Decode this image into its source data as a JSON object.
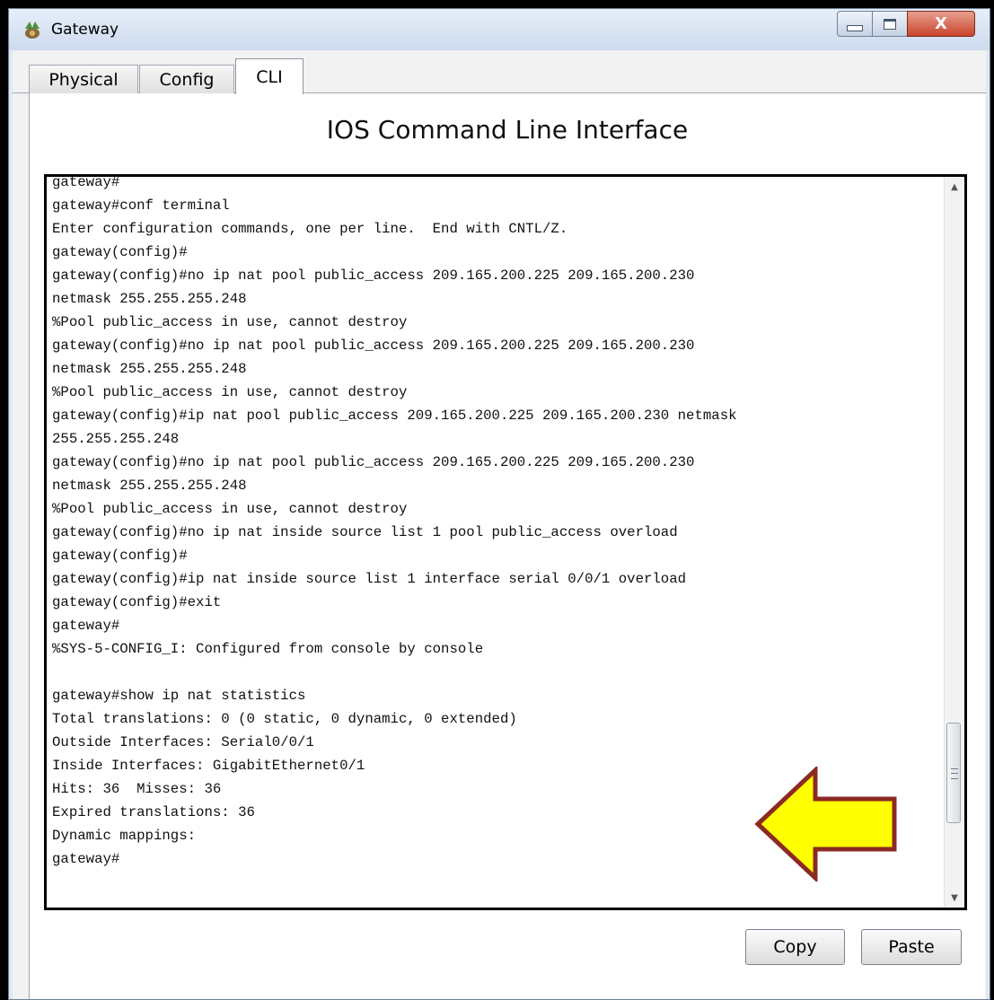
{
  "window": {
    "title": "Gateway",
    "close_symbol": "X",
    "icons": {
      "app": "network-device-icon",
      "minimize": "minimize-icon",
      "maximize": "maximize-icon",
      "close": "close-icon"
    }
  },
  "tabs": [
    {
      "label": "Physical",
      "active": false
    },
    {
      "label": "Config",
      "active": false
    },
    {
      "label": "CLI",
      "active": true
    }
  ],
  "cli": {
    "heading": "IOS Command Line Interface",
    "lines": [
      "gateway#",
      "gateway#conf terminal",
      "Enter configuration commands, one per line.  End with CNTL/Z.",
      "gateway(config)#",
      "gateway(config)#no ip nat pool public_access 209.165.200.225 209.165.200.230",
      "netmask 255.255.255.248",
      "%Pool public_access in use, cannot destroy",
      "gateway(config)#no ip nat pool public_access 209.165.200.225 209.165.200.230",
      "netmask 255.255.255.248",
      "%Pool public_access in use, cannot destroy",
      "gateway(config)#ip nat pool public_access 209.165.200.225 209.165.200.230 netmask",
      "255.255.255.248",
      "gateway(config)#no ip nat pool public_access 209.165.200.225 209.165.200.230",
      "netmask 255.255.255.248",
      "%Pool public_access in use, cannot destroy",
      "gateway(config)#no ip nat inside source list 1 pool public_access overload",
      "gateway(config)#",
      "gateway(config)#ip nat inside source list 1 interface serial 0/0/1 overload",
      "gateway(config)#exit",
      "gateway#",
      "%SYS-5-CONFIG_I: Configured from console by console",
      "",
      "gateway#show ip nat statistics",
      "Total translations: 0 (0 static, 0 dynamic, 0 extended)",
      "Outside Interfaces: Serial0/0/1",
      "Inside Interfaces: GigabitEthernet0/1",
      "Hits: 36  Misses: 36",
      "Expired translations: 36",
      "Dynamic mappings:",
      "gateway#"
    ]
  },
  "buttons": {
    "copy": "Copy",
    "paste": "Paste"
  },
  "annotation": {
    "shape": "arrow-left",
    "fill": "#ffff00",
    "stroke": "#8b2a22"
  }
}
